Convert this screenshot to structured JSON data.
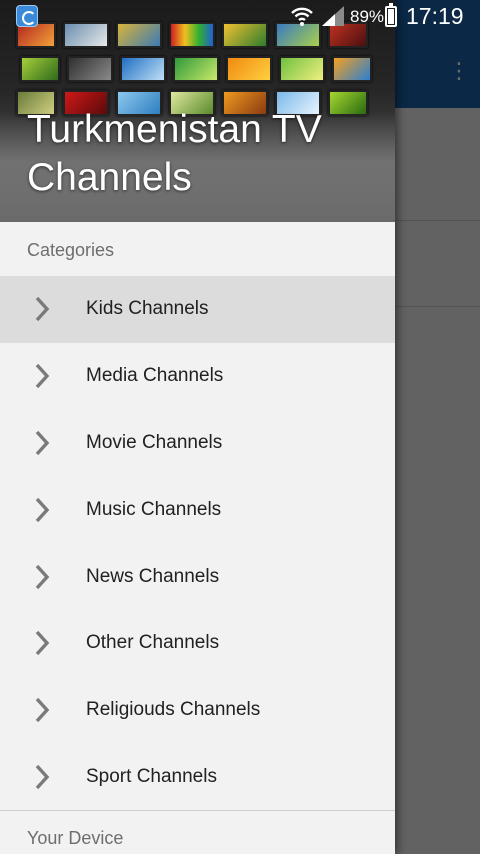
{
  "status_bar": {
    "battery_percent": "89%",
    "time": "17:19",
    "icons": [
      "app-notification-icon",
      "wifi-icon",
      "signal-icon",
      "battery-icon"
    ]
  },
  "drawer": {
    "header_title": "Turkmenistan TV Channels",
    "categories_label": "Categories",
    "items": [
      {
        "label": "Kids Channels",
        "active": true
      },
      {
        "label": "Media Channels",
        "active": false
      },
      {
        "label": "Movie Channels",
        "active": false
      },
      {
        "label": "Music Channels",
        "active": false
      },
      {
        "label": "News Channels",
        "active": false
      },
      {
        "label": "Other Channels",
        "active": false
      },
      {
        "label": "Religiouds Channels",
        "active": false
      },
      {
        "label": "Sport Channels",
        "active": false
      }
    ],
    "device_label": "Your Device"
  },
  "colors": {
    "toolbar_blue": "#1c5fa6",
    "drawer_bg": "#f2f2f2",
    "active_item_bg": "#dcdcdc",
    "section_label": "#6e6e6e"
  }
}
